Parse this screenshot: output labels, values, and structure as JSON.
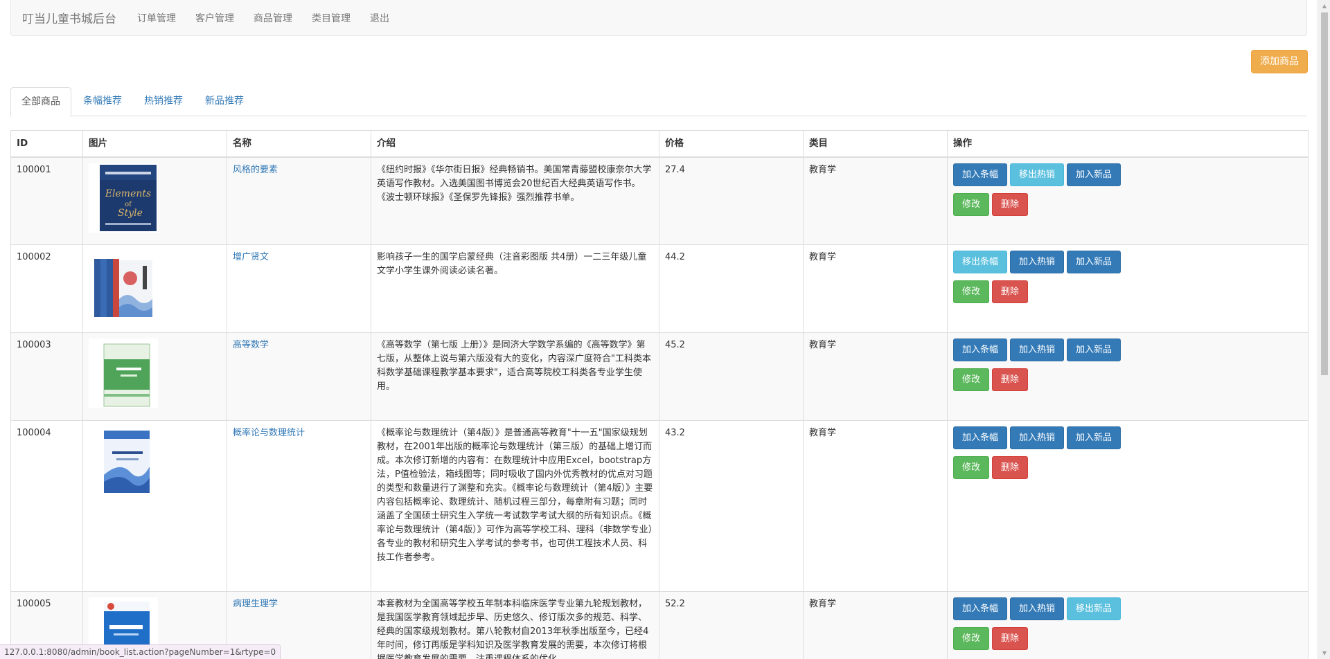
{
  "navbar": {
    "brand": "叮当儿童书城后台",
    "items": [
      "订单管理",
      "客户管理",
      "商品管理",
      "类目管理",
      "退出"
    ]
  },
  "add_button": "添加商品",
  "tabs": [
    "全部商品",
    "条幅推荐",
    "热销推荐",
    "新品推荐"
  ],
  "table": {
    "headers": [
      "ID",
      "图片",
      "名称",
      "介绍",
      "价格",
      "类目",
      "操作"
    ],
    "rows": [
      {
        "id": "100001",
        "cover_icon": "book-cover-elements-of-style",
        "name": "风格的要素",
        "desc": "《纽约时报》《华尔街日报》经典畅销书。美国常青藤盟校康奈尔大学英语写作教材。入选美国图书博览会20世纪百大经典英语写作书。《波士顿环球报》《圣保罗先锋报》强烈推荐书单。",
        "price": "27.4",
        "category": "教育学",
        "btn1": "加入条幅",
        "btn2": "移出热销",
        "btn3": "加入新品",
        "edit": "修改",
        "delete": "删除"
      },
      {
        "id": "100002",
        "cover_icon": "book-cover-zengguang-xianwen",
        "name": "增广贤文",
        "desc": "影响孩子一生的国学启蒙经典（注音彩图版 共4册）一二三年级儿童文学小学生课外阅读必读名著。",
        "price": "44.2",
        "category": "教育学",
        "btn1": "移出条幅",
        "btn2": "加入热销",
        "btn3": "加入新品",
        "edit": "修改",
        "delete": "删除"
      },
      {
        "id": "100003",
        "cover_icon": "book-cover-advanced-math",
        "name": "高等数学",
        "desc": "《高等数学（第七版 上册）》是同济大学数学系编的《高等数学》第七版，从整体上说与第六版没有大的变化，内容深广度符合\"工科类本科数学基础课程教学基本要求\"，适合高等院校工科类各专业学生使用。",
        "price": "45.2",
        "category": "教育学",
        "btn1": "加入条幅",
        "btn2": "加入热销",
        "btn3": "加入新品",
        "edit": "修改",
        "delete": "删除"
      },
      {
        "id": "100004",
        "cover_icon": "book-cover-probability",
        "name": "概率论与数理统计",
        "desc": "《概率论与数理统计（第4版）》是普通高等教育\"十一五\"国家级规划教材，在2001年出版的概率论与数理统计（第三版）的基础上增订而成。本次修订新增的内容有：在数理统计中应用Excel，bootstrap方法，P值检验法，箱线图等；同时吸收了国内外优秀教材的优点对习题的类型和数量进行了渊整和充实。《概率论与数理统计（第4版）》主要内容包括概率论、数理统计、随机过程三部分，每章附有习题；同时涵盖了全国硕士研究生入学统一考试数学考试大纲的所有知识点。《概率论与数理统计（第4版）》可作为高等学校工科、理科（非数学专业）各专业的教材和研究生入学考试的参考书，也可供工程技术人员、科技工作者参考。",
        "price": "43.2",
        "category": "教育学",
        "btn1": "加入条幅",
        "btn2": "加入热销",
        "btn3": "加入新品",
        "edit": "修改",
        "delete": "删除"
      },
      {
        "id": "100005",
        "cover_icon": "book-cover-pathophysiology",
        "name": "病理生理学",
        "desc": "本套教材为全国高等学校五年制本科临床医学专业第九轮规划教材，是我国医学教育领域起步早、历史悠久、修订版次多的规范、科学、经典的国家级规划教材。第八轮教材自2013年秋季出版至今，已经4年时间，修订再版是学科知识及医学教育发展的需要，本次修订将根据医学教育发展的需要，注重课程体系的优化",
        "price": "52.2",
        "category": "教育学",
        "btn1": "加入条幅",
        "btn2": "加入热销",
        "btn3": "移出新品",
        "edit": "修改",
        "delete": "删除"
      }
    ]
  },
  "status_url": "127.0.0.1:8080/admin/book_list.action?pageNumber=1&rtype=0",
  "colors": {
    "primary": "#337ab7",
    "info": "#5bc0de",
    "success": "#5cb85c",
    "danger": "#d9534f",
    "warning": "#f0ad4e"
  }
}
